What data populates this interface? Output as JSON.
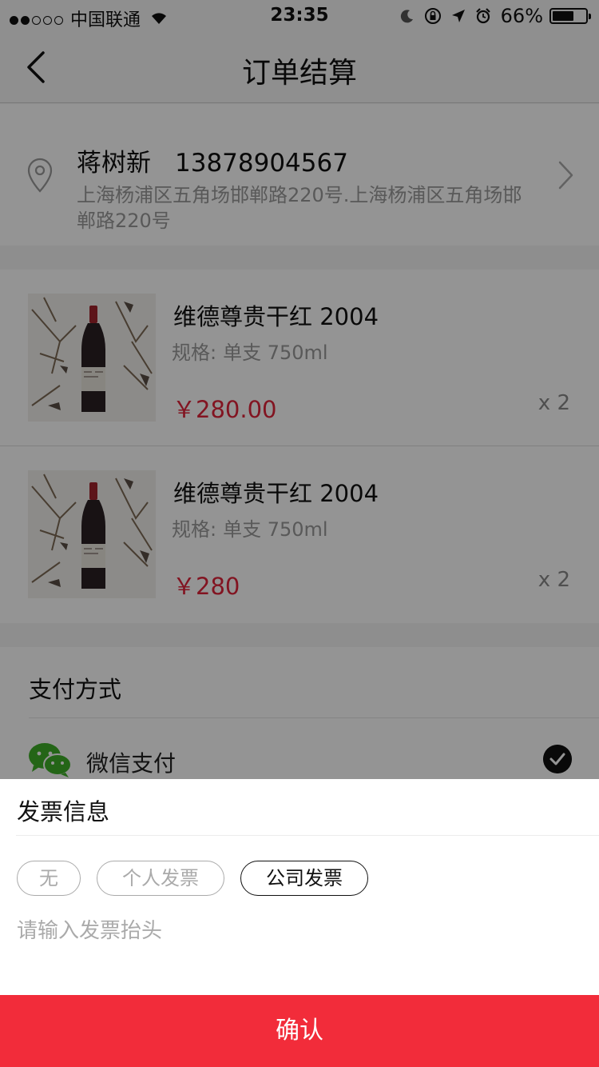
{
  "status_bar": {
    "signal_dots": [
      true,
      true,
      false,
      false,
      false
    ],
    "carrier": "中国联通",
    "time": "23:35",
    "battery_text": "66%",
    "battery_level": 0.66,
    "icons": [
      "wifi-icon",
      "moon-icon",
      "rotation-lock-icon",
      "location-arrow-icon",
      "alarm-icon",
      "battery-icon"
    ]
  },
  "nav": {
    "title": "订单结算",
    "back_icon": "chevron-left-icon"
  },
  "address": {
    "name": "蒋树新",
    "phone": "13878904567",
    "text": "上海杨浦区五角场邯郸路220号.上海杨浦区五角场邯郸路220号",
    "icon": "location-pin-icon"
  },
  "products": [
    {
      "name": "维德尊贵干红 2004",
      "spec_label": "规格:",
      "spec_value": "单支 750ml",
      "price": "￥280.00",
      "qty": "x 2"
    },
    {
      "name": "维德尊贵干红 2004",
      "spec_label": "规格:",
      "spec_value": "单支 750ml",
      "price": "￥280",
      "qty": "x 2"
    }
  ],
  "payment": {
    "title": "支付方式",
    "method": "微信支付",
    "selected": true,
    "icon": "wechat-icon"
  },
  "invoice": {
    "title": "发票信息",
    "options": [
      "无",
      "个人发票",
      "公司发票"
    ],
    "selected": "公司发票",
    "placeholder": "请输入发票抬头"
  },
  "confirm_label": "确认",
  "colors": {
    "accent": "#f22c3a",
    "price": "#e0243a",
    "overlay": "rgba(0,0,0,0.42)"
  }
}
